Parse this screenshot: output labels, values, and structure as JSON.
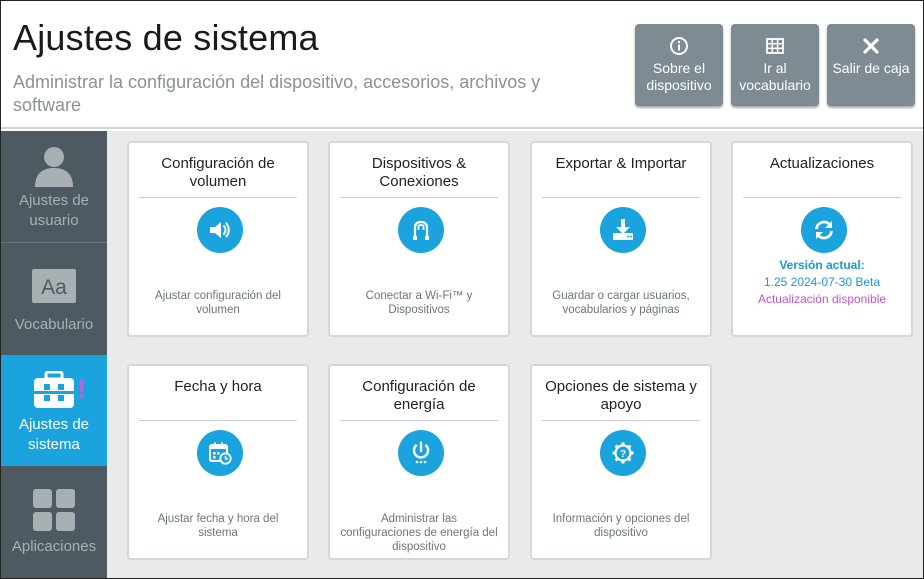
{
  "header": {
    "title": "Ajustes de sistema",
    "subtitle": "Administrar la configuración del dispositivo, accesorios, archivos y software",
    "buttons": [
      {
        "label": "Sobre el dispositivo",
        "icon": "info-icon"
      },
      {
        "label": "Ir al vocabulario",
        "icon": "grid-icon"
      },
      {
        "label": "Salir de caja",
        "icon": "close-icon"
      }
    ]
  },
  "sidebar": {
    "items": [
      {
        "label": "Ajustes de usuario",
        "icon": "user-icon",
        "active": false
      },
      {
        "label": "Vocabulario",
        "icon": "aa-icon",
        "active": false
      },
      {
        "label": "Ajustes de sistema",
        "icon": "toolbox-icon",
        "active": true,
        "badge": "!"
      },
      {
        "label": "Aplicaciones",
        "icon": "apps-icon",
        "active": false
      }
    ]
  },
  "cards": [
    {
      "title": "Configuración de volumen",
      "description": "Ajustar configuración del volumen",
      "icon": "speaker-icon"
    },
    {
      "title": "Dispositivos & Conexiones",
      "description": "Conectar a Wi-Fi™ y Dispositivos",
      "icon": "connection-icon"
    },
    {
      "title": "Exportar & Importar",
      "description": "Guardar o cargar usuarios, vocabularios y páginas",
      "icon": "download-icon"
    },
    {
      "title": "Actualizaciones",
      "version_label": "Versión actual:",
      "version_value": "1.25 2024-07-30 Beta",
      "update_status": "Actualización disponible",
      "icon": "refresh-icon"
    },
    {
      "title": "Fecha y hora",
      "description": "Ajustar fecha y hora del sistema",
      "icon": "calendar-clock-icon"
    },
    {
      "title": "Configuración de energía",
      "description": "Administrar las configuraciones de energía del dispositivo",
      "icon": "power-icon"
    },
    {
      "title": "Opciones de sistema y apoyo",
      "description": "Información y opciones del dispositivo",
      "icon": "gear-help-icon"
    }
  ],
  "colors": {
    "accent": "#1aa3dc",
    "sidebar": "#4d5a61",
    "header_button": "#7e8b92",
    "update_available": "#c054c8",
    "version_text": "#1d96d4"
  }
}
